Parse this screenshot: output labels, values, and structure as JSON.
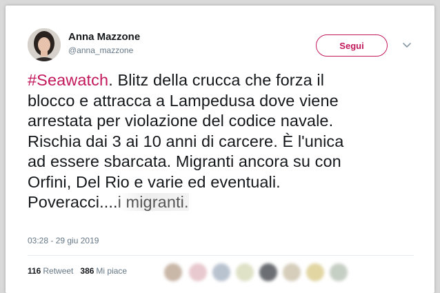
{
  "tweet": {
    "author_name": "Anna Mazzone",
    "author_handle": "@anna_mazzone",
    "follow_label": "Segui",
    "hashtag": "#Seawatch",
    "text_lines": [
      ". Blitz della crucca che forza il",
      "blocco e attracca a Lampedusa dove viene",
      "arrestata per violazione del codice navale.",
      "Rischia dai 3 ai 10 anni di carcere. È l'unica",
      "ad essere sbarcata. Migranti ancora su con",
      "Orfini, Del Rio e varie ed eventuali.",
      "Poveracci....",
      "i migranti."
    ],
    "timestamp": "03:28 - 29 giu 2019",
    "retweet_count": "116",
    "retweet_label": "Retweet",
    "like_count": "386",
    "like_label": "Mi piace"
  },
  "icons": {
    "chevron": "chevron-down-icon"
  },
  "colors": {
    "accent": "#c2185b",
    "text": "#14171a",
    "muted": "#657786"
  }
}
